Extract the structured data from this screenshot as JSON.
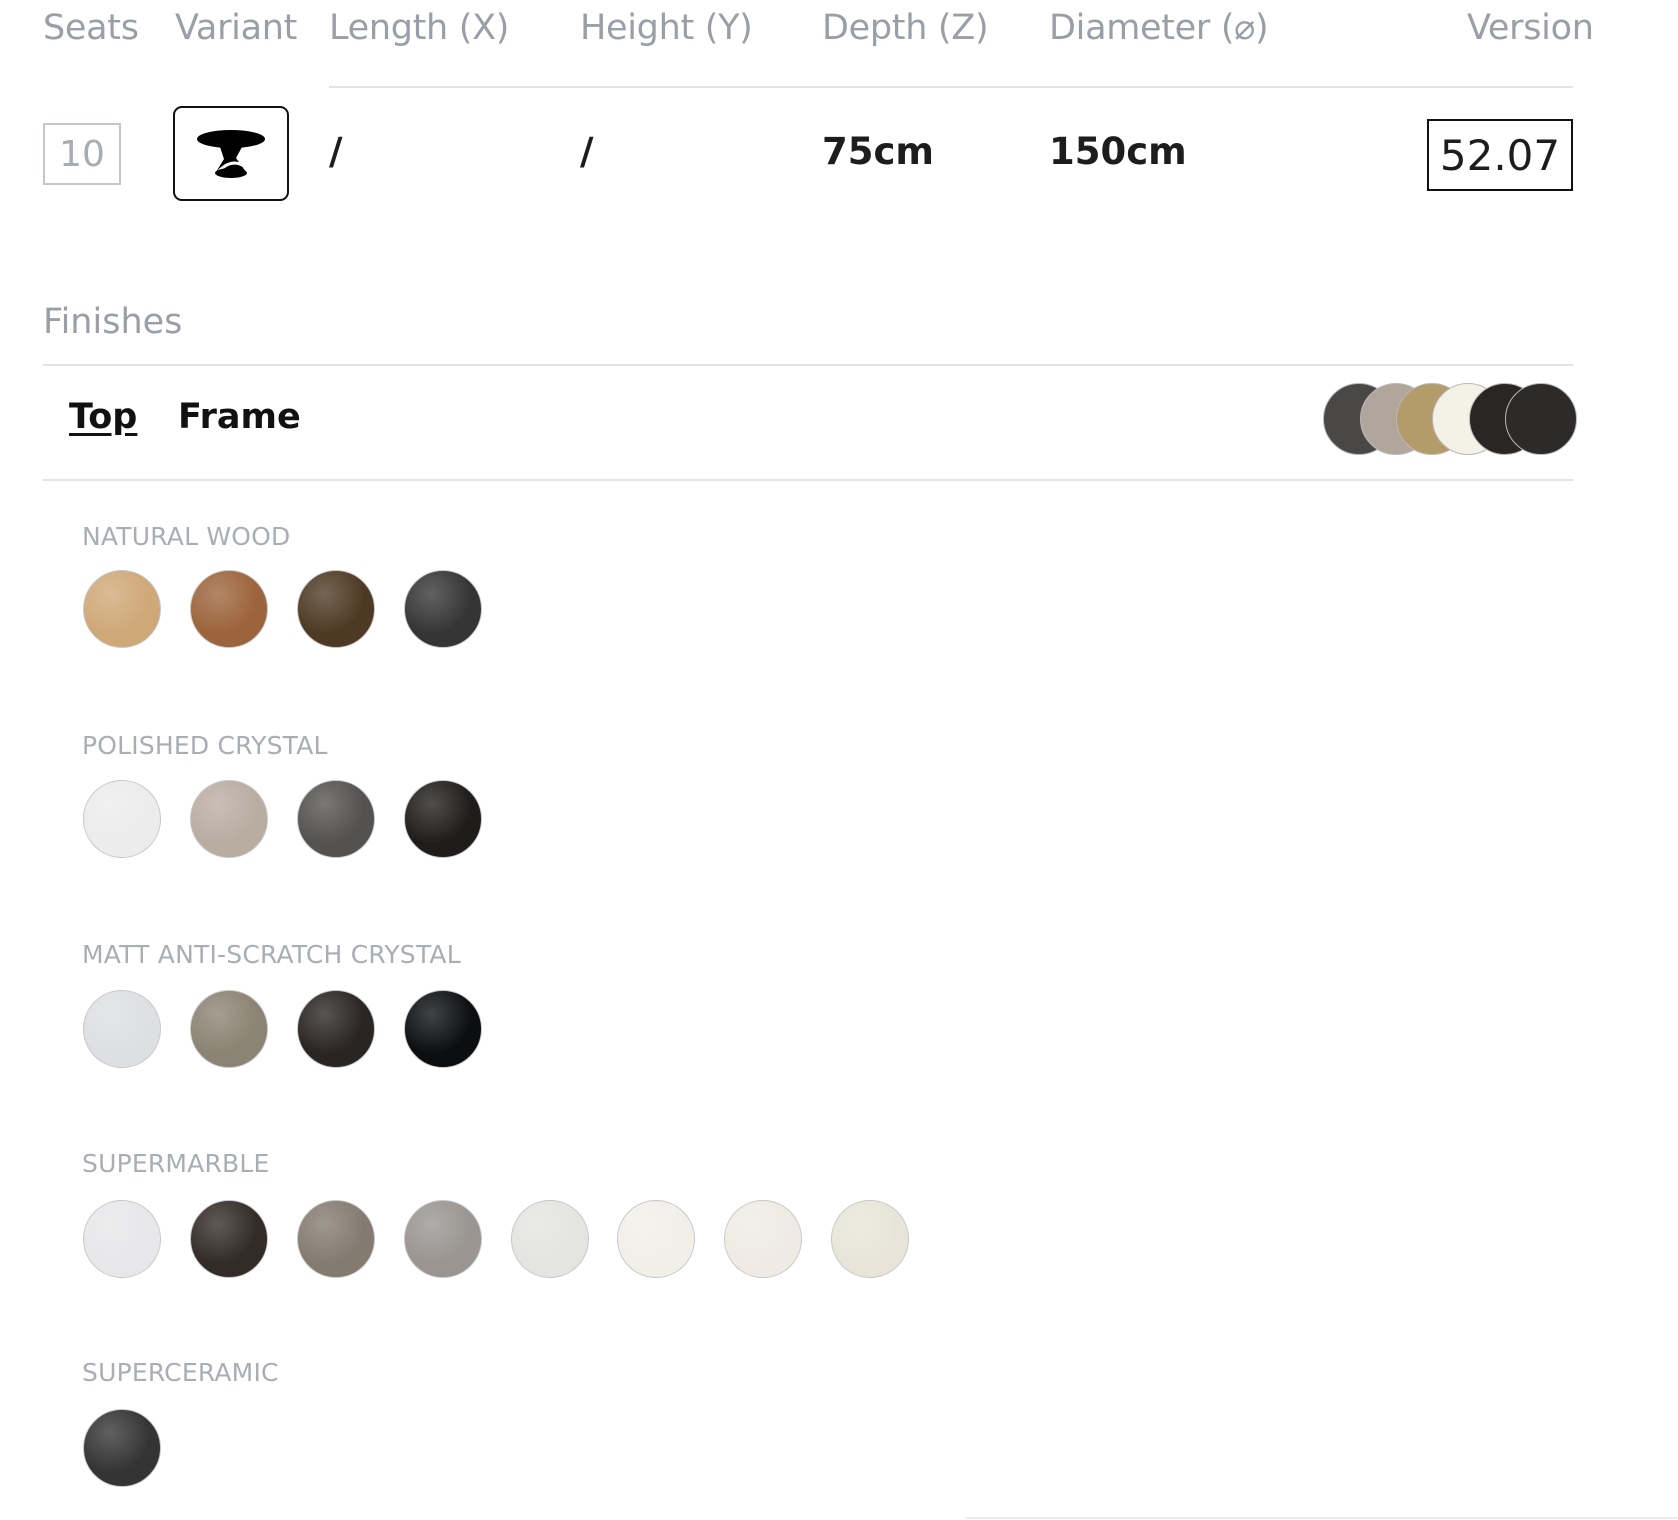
{
  "specs": {
    "headers": {
      "seats": "Seats",
      "variant": "Variant",
      "length": "Length (X)",
      "height": "Height (Y)",
      "depth": "Depth (Z)",
      "diameter": "Diameter (⌀)",
      "version": "Version"
    },
    "values": {
      "seats": "10",
      "variant_icon": "round-table-icon",
      "length": "/",
      "height": "/",
      "depth": "75cm",
      "diameter": "150cm",
      "version": "52.07"
    }
  },
  "finishes": {
    "title": "Finishes",
    "tabs": [
      {
        "label": "Top",
        "active": true
      },
      {
        "label": "Frame",
        "active": false
      }
    ],
    "selected_stack": [
      "#4a4846",
      "#b0a69b",
      "#b39c6a",
      "#f4f1e7",
      "#2a2624",
      "#2d2b2a"
    ],
    "groups": [
      {
        "label": "NATURAL WOOD",
        "swatches": [
          {
            "name": "natural-oak",
            "color": "#cfa878"
          },
          {
            "name": "walnut-canaletto",
            "color": "#9c643c"
          },
          {
            "name": "dark-walnut",
            "color": "#4e3a24"
          },
          {
            "name": "black-oak",
            "color": "#353535"
          }
        ]
      },
      {
        "label": "POLISHED CRYSTAL",
        "swatches": [
          {
            "name": "white",
            "color": "#ececec"
          },
          {
            "name": "taupe",
            "color": "#b9ada2"
          },
          {
            "name": "grey",
            "color": "#545250"
          },
          {
            "name": "black",
            "color": "#201c1b"
          }
        ]
      },
      {
        "label": "MATT ANTI-SCRATCH CRYSTAL",
        "swatches": [
          {
            "name": "white",
            "color": "#dedfe2"
          },
          {
            "name": "dove",
            "color": "#8b8373"
          },
          {
            "name": "dark-brown",
            "color": "#2a2522"
          },
          {
            "name": "black",
            "color": "#0c0e12"
          }
        ]
      },
      {
        "label": "SUPERMARBLE",
        "swatches": [
          {
            "name": "calacatta-white",
            "color": "#e7e7e9"
          },
          {
            "name": "sahara-noir",
            "color": "#332b27"
          },
          {
            "name": "grey-onyx",
            "color": "#847b70"
          },
          {
            "name": "breccia",
            "color": "#9a9591"
          },
          {
            "name": "statuario",
            "color": "#e4e5e2"
          },
          {
            "name": "calacatta-gold",
            "color": "#f2efe9"
          },
          {
            "name": "arabescato",
            "color": "#efebe4"
          },
          {
            "name": "cream",
            "color": "#e8e5d8"
          }
        ]
      },
      {
        "label": "SUPERCERAMIC",
        "swatches": [
          {
            "name": "black-stone",
            "color": "#343434"
          }
        ]
      }
    ]
  }
}
